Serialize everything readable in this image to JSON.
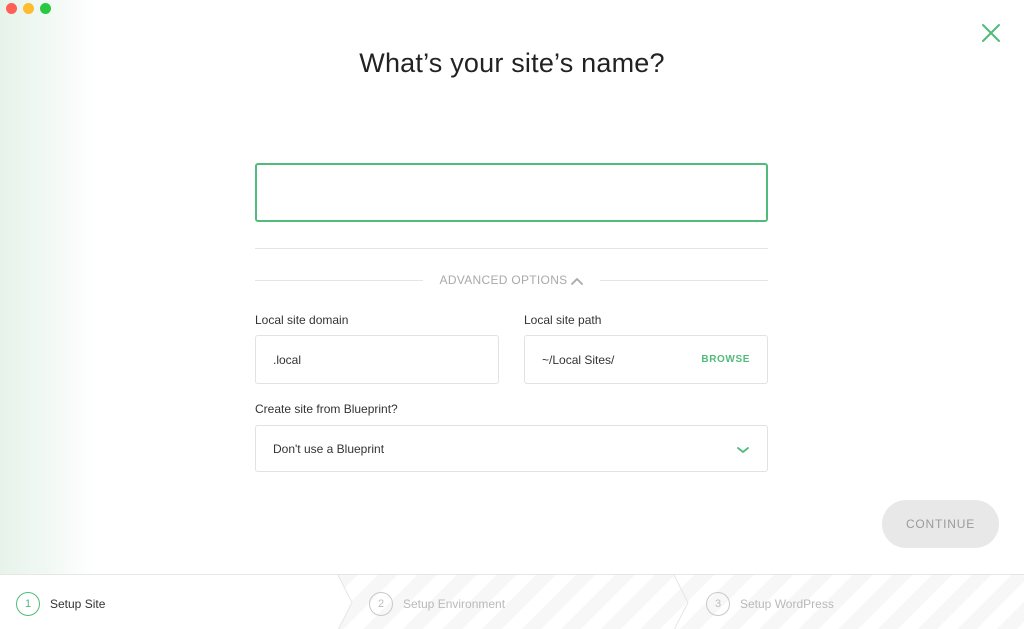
{
  "window": {
    "traffic_lights": [
      {
        "name": "close",
        "color": "#ff5f57"
      },
      {
        "name": "minimize",
        "color": "#febc2e"
      },
      {
        "name": "maximize",
        "color": "#28c840"
      }
    ]
  },
  "header": {
    "title": "What’s your site’s name?"
  },
  "site_name": {
    "value": "",
    "placeholder": ""
  },
  "advanced": {
    "label": "ADVANCED OPTIONS",
    "expanded": true
  },
  "domain": {
    "label": "Local site domain",
    "value": ".local"
  },
  "path": {
    "label": "Local site path",
    "value": "~/Local Sites/",
    "browse_label": "BROWSE"
  },
  "blueprint": {
    "label": "Create site from Blueprint?",
    "selected": "Don't use a Blueprint"
  },
  "continue": {
    "label": "CONTINUE",
    "enabled": false
  },
  "steps": [
    {
      "number": "1",
      "label": "Setup Site",
      "active": true
    },
    {
      "number": "2",
      "label": "Setup Environment",
      "active": false
    },
    {
      "number": "3",
      "label": "Setup WordPress",
      "active": false
    }
  ],
  "colors": {
    "accent": "#51bb7b",
    "muted": "#a9a9a9",
    "button_disabled_bg": "#e8e8e8"
  }
}
